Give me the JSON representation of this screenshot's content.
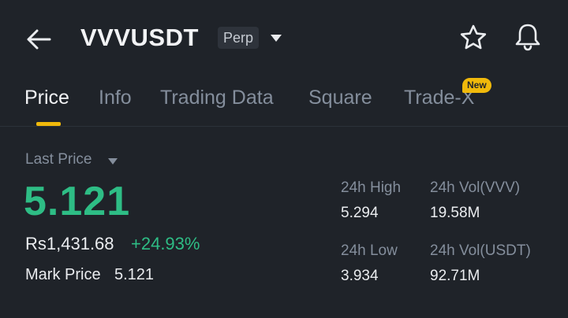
{
  "header": {
    "symbol": "VVVUSDT",
    "contract_type": "Perp",
    "icons": {
      "back": "back-arrow-icon",
      "caret": "caret-down-icon",
      "favorite": "star-icon",
      "alerts": "bell-icon"
    }
  },
  "tabs": [
    {
      "label": "Price",
      "active": true
    },
    {
      "label": "Info",
      "active": false
    },
    {
      "label": "Trading Data",
      "active": false
    },
    {
      "label": "Square",
      "active": false
    },
    {
      "label": "Trade-X",
      "active": false,
      "badge": "New"
    }
  ],
  "price_panel": {
    "last_price_label": "Last Price",
    "last_price": "5.121",
    "fiat_price": "Rs1,431.68",
    "change_percent": "+24.93%",
    "mark_price_label": "Mark Price",
    "mark_price": "5.121"
  },
  "stats": {
    "high_label": "24h High",
    "high_value": "5.294",
    "low_label": "24h Low",
    "low_value": "3.934",
    "vol_base_label": "24h Vol(VVV)",
    "vol_base_value": "19.58M",
    "vol_quote_label": "24h Vol(USDT)",
    "vol_quote_value": "92.71M"
  },
  "colors": {
    "background": "#1f2329",
    "accent": "#f0b90b",
    "positive": "#2ebd85",
    "muted_text": "#848e9c"
  }
}
